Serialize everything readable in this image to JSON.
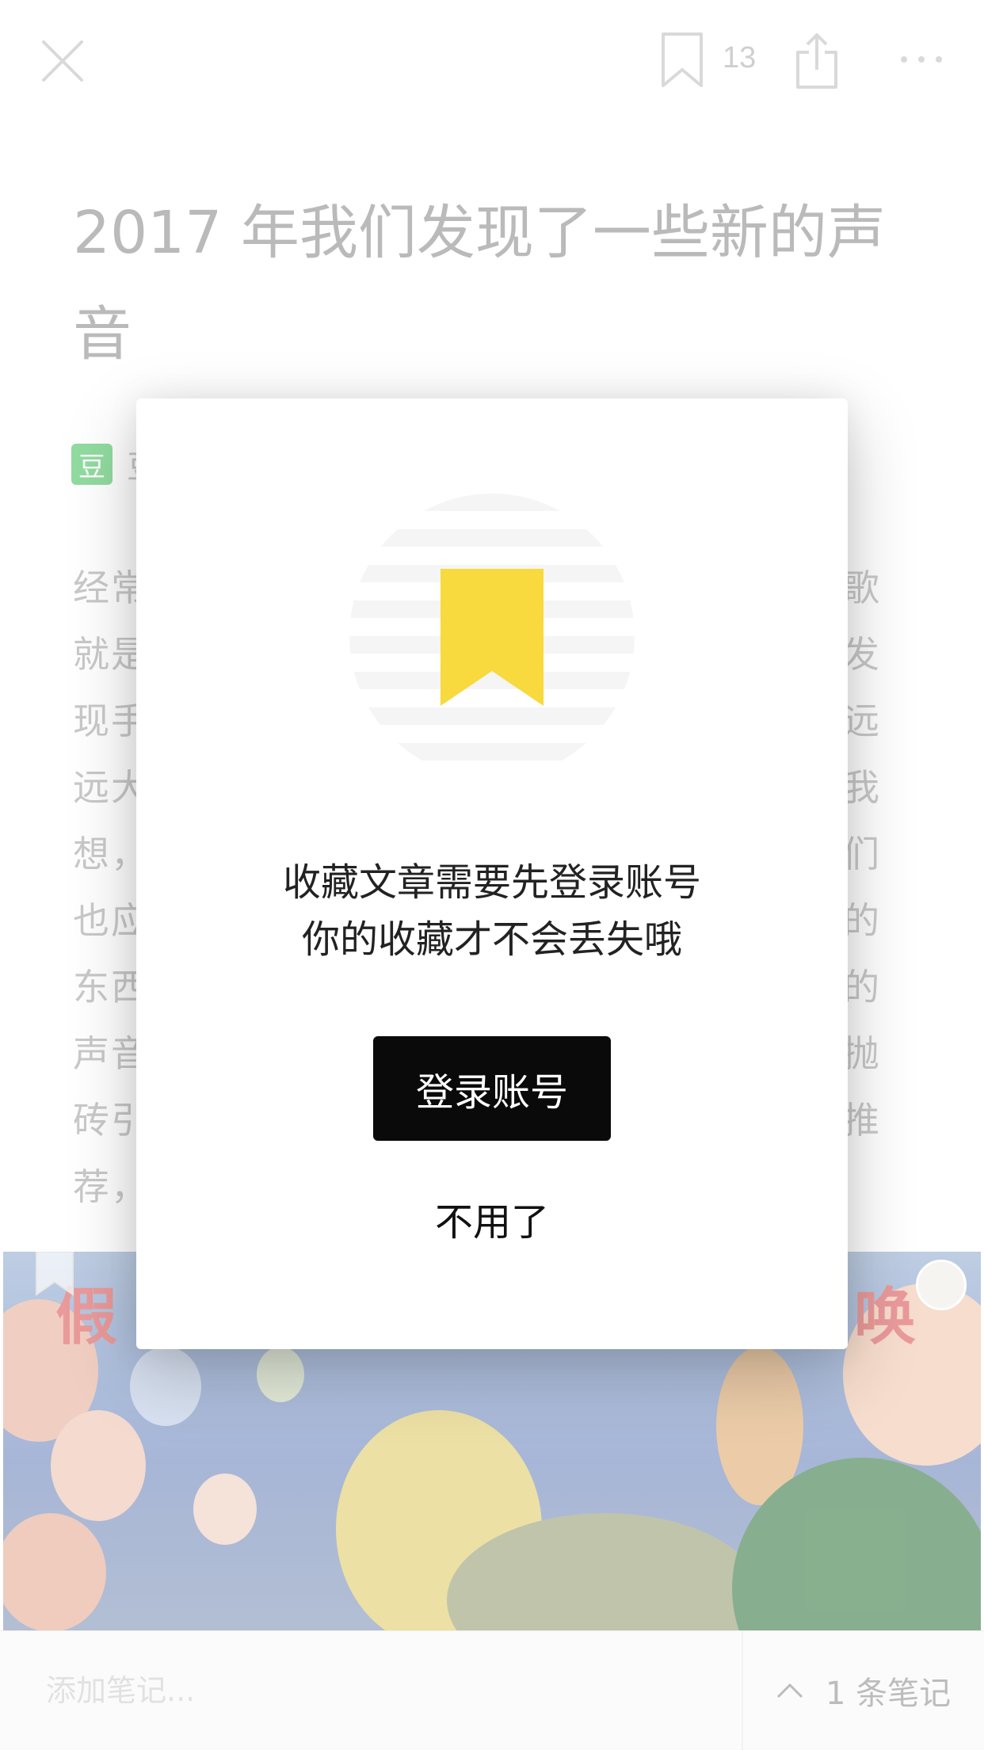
{
  "topbar": {
    "bookmark_count": "13",
    "icons": {
      "close": "close-icon",
      "bookmark": "bookmark-icon",
      "share": "share-icon",
      "more": "more-icon"
    }
  },
  "article": {
    "title": "2017 年我们发现了一些新的声音",
    "author_badge": "豆",
    "author_name": "豆",
    "paragraph_lines": [
      {
        "left": "经常",
        "right": "歌"
      },
      {
        "left": "就是",
        "right": "发"
      },
      {
        "left": "现手",
        "right": "远"
      },
      {
        "left": "远大",
        "right": "我"
      },
      {
        "left": "想，",
        "right": "们"
      },
      {
        "left": "也应",
        "right": "的"
      },
      {
        "left": "东西",
        "right": "的"
      },
      {
        "left": "声音",
        "right": "抛"
      },
      {
        "left": "砖引",
        "right": "推"
      },
      {
        "left": "荐，",
        "right": ""
      }
    ],
    "hero_poster_text_left": "假",
    "hero_poster_text_right": "唤"
  },
  "bottombar": {
    "note_placeholder": "添加笔记...",
    "notes_label": "1 条笔记"
  },
  "modal": {
    "message_line1": "收藏文章需要先登录账号",
    "message_line2": "你的收藏才不会丢失哦",
    "login_label": "登录账号",
    "decline_label": "不用了",
    "accent_color": "#f8d93e"
  }
}
